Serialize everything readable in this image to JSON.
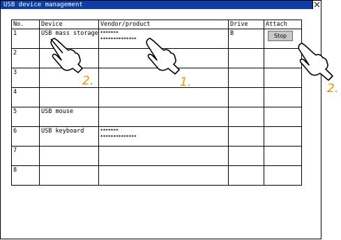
{
  "window": {
    "title": "USB device management"
  },
  "columns": [
    "No.",
    "Device",
    "Vendor/product",
    "Drive",
    "Attach"
  ],
  "rows": [
    {
      "no": "1",
      "device": "USB mass storage",
      "vendor": "*******",
      "product": "**************",
      "drive": "B",
      "attach": "Stop"
    },
    {
      "no": "2",
      "device": "",
      "vendor": "",
      "product": "",
      "drive": "",
      "attach": ""
    },
    {
      "no": "3",
      "device": "",
      "vendor": "",
      "product": "",
      "drive": "",
      "attach": ""
    },
    {
      "no": "4",
      "device": "",
      "vendor": "",
      "product": "",
      "drive": "",
      "attach": ""
    },
    {
      "no": "5",
      "device": "USB mouse",
      "vendor": "",
      "product": "",
      "drive": "",
      "attach": ""
    },
    {
      "no": "6",
      "device": "USB keyboard",
      "vendor": "*******",
      "product": "**************",
      "drive": "",
      "attach": ""
    },
    {
      "no": "7",
      "device": "",
      "vendor": "",
      "product": "",
      "drive": "",
      "attach": ""
    },
    {
      "no": "8",
      "device": "",
      "vendor": "",
      "product": "",
      "drive": "",
      "attach": ""
    }
  ],
  "callouts": [
    {
      "label": "2.",
      "icon": "pointing-hand-icon"
    },
    {
      "label": "1.",
      "icon": "pointing-hand-icon"
    },
    {
      "label": "2.",
      "icon": "pointing-hand-icon"
    }
  ],
  "colors": {
    "title_bar": "#0b3ea8",
    "callout_number": "#f39200",
    "button": "#c8c8c8"
  }
}
